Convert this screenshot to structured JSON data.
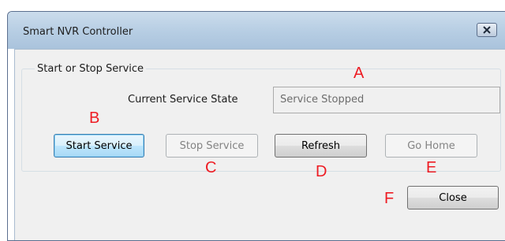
{
  "window": {
    "title": "Smart NVR Controller",
    "close_glyph": "✕"
  },
  "group": {
    "label": "Start or Stop Service"
  },
  "service_state": {
    "label": "Current Service State",
    "value": "Service Stopped"
  },
  "buttons": {
    "start": "Start Service",
    "stop": "Stop Service",
    "refresh": "Refresh",
    "go_home": "Go Home",
    "close": "Close"
  },
  "annotations": {
    "a": "A",
    "b": "B",
    "c": "C",
    "d": "D",
    "e": "E",
    "f": "F"
  },
  "colors": {
    "annotation": "#ee1c23",
    "default_button_border": "#3c7fb1",
    "titlebar": "#b6cde3"
  }
}
